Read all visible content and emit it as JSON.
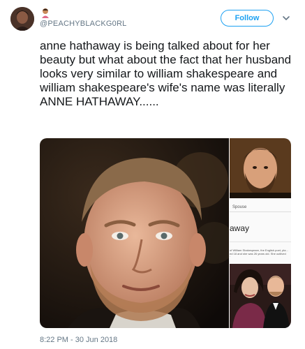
{
  "tweet": {
    "handle": "@PEACHYBLACKG0RL",
    "follow_label": "Follow",
    "text": "anne hathaway is being talked about for her beauty but what about the fact that her husband looks very similar to william shakespeare and william shakespeare's wife's name was literally ANNE HATHAWAY......",
    "timestamp": "8:22 PM - 30 Jun 2018"
  },
  "media": {
    "side_caption": "Spouse",
    "side_fragment": "away",
    "side_snippet": "of William Shakespeare, the English poet, pla... ed 18 and she was 26 years old. She outlived he..."
  },
  "colors": {
    "accent": "#1da1f2",
    "text": "#14171a",
    "secondary": "#657786"
  },
  "icons": {
    "avatar": "user-avatar",
    "badge": "emoji-badge-icon",
    "menu": "chevron-down-icon"
  }
}
